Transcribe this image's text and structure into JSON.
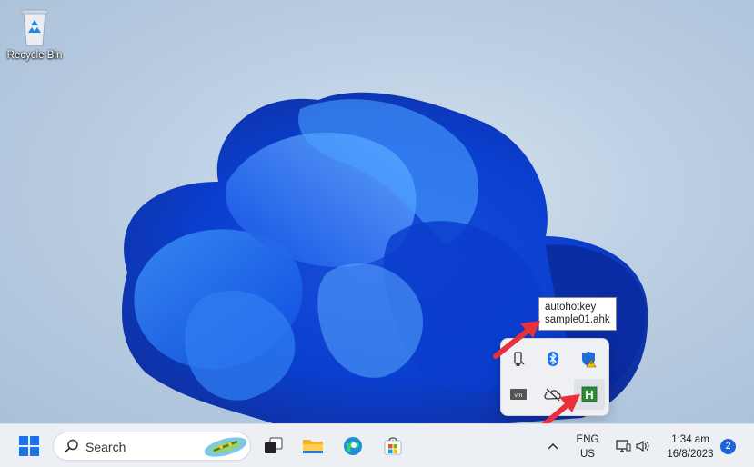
{
  "desktop": {
    "icons": [
      {
        "label": "Recycle Bin",
        "icon": "recycle-bin-icon"
      }
    ]
  },
  "tooltip": {
    "line1": "autohotkey",
    "line2": "sample01.ahk"
  },
  "tray_overflow": {
    "icons": [
      "usb-drive-icon",
      "bluetooth-icon",
      "windows-security-warning-icon",
      "vmware-icon",
      "onedrive-offline-icon",
      "autohotkey-icon"
    ]
  },
  "taskbar": {
    "search_placeholder": "Search",
    "apps": [
      "start-icon",
      "task-view-icon",
      "file-explorer-icon",
      "edge-icon",
      "microsoft-store-icon"
    ],
    "language_line1": "ENG",
    "language_line2": "US",
    "time": "1:34 am",
    "date": "16/8/2023",
    "notification_count": "2"
  },
  "colors": {
    "accent": "#1f63d6",
    "annotation_arrow": "#e8303a",
    "taskbar_bg": "#eceff3"
  }
}
